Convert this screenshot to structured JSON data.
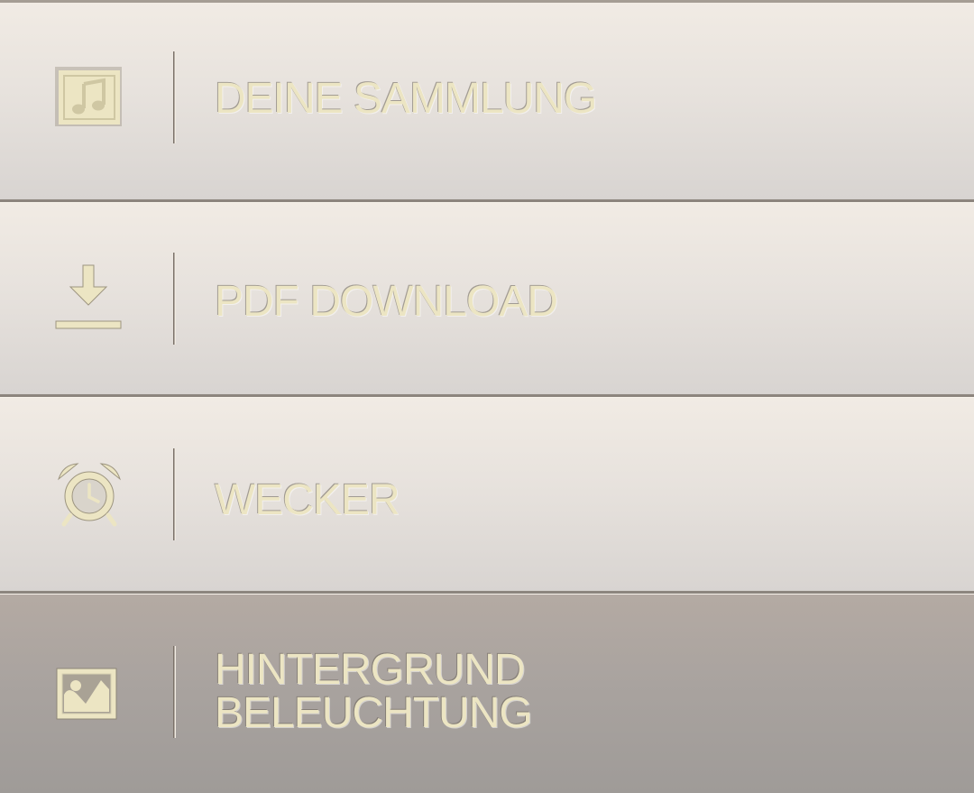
{
  "menu": {
    "items": [
      {
        "label_line1": "DEINE SAMMLUNG",
        "label_line2": "",
        "icon": "music-note-icon",
        "selected": false
      },
      {
        "label_line1": "PDF DOWNLOAD",
        "label_line2": "",
        "icon": "download-icon",
        "selected": false
      },
      {
        "label_line1": "WECKER",
        "label_line2": "",
        "icon": "alarm-clock-icon",
        "selected": false
      },
      {
        "label_line1": "HINTERGRUND",
        "label_line2": "BELEUCHTUNG",
        "icon": "image-icon",
        "selected": true
      }
    ]
  },
  "colors": {
    "label_text": "#ece5c3",
    "icon_fill": "#ece5c3",
    "row_light_top": "#f1ebe4",
    "row_light_bottom": "#d8d4d1",
    "row_selected_top": "#b4aaa3",
    "row_selected_bottom": "#9f9b98",
    "separator": "#8c857e"
  }
}
